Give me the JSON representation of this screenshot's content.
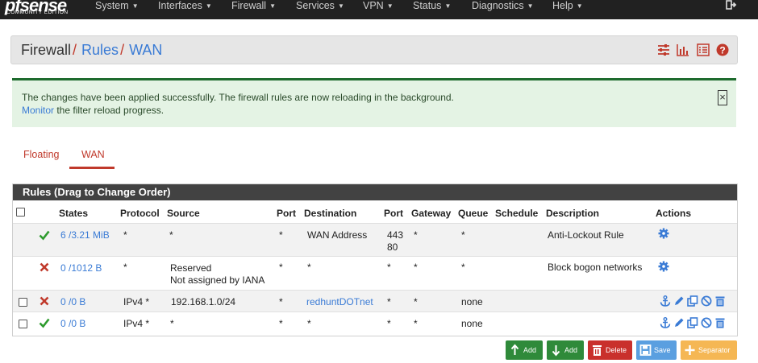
{
  "brand": {
    "logo_top": "pfsense",
    "logo_bottom": "COMMUNITY EDITION"
  },
  "nav": {
    "items": [
      {
        "label": "System"
      },
      {
        "label": "Interfaces"
      },
      {
        "label": "Firewall"
      },
      {
        "label": "Services"
      },
      {
        "label": "VPN"
      },
      {
        "label": "Status"
      },
      {
        "label": "Diagnostics"
      },
      {
        "label": "Help"
      }
    ]
  },
  "breadcrumb": {
    "root": "Firewall",
    "level2": "Rules",
    "level3": "WAN"
  },
  "alert": {
    "line1": "The changes have been applied successfully. The firewall rules are now reloading in the background.",
    "monitor_link": "Monitor",
    "line2_rest": " the filter reload progress.",
    "close": "×"
  },
  "tabs": [
    {
      "label": "Floating"
    },
    {
      "label": "WAN"
    }
  ],
  "panel": {
    "title": "Rules (Drag to Change Order)"
  },
  "table": {
    "headers": {
      "states": "States",
      "protocol": "Protocol",
      "source": "Source",
      "port": "Port",
      "destination": "Destination",
      "dport": "Port",
      "gateway": "Gateway",
      "queue": "Queue",
      "schedule": "Schedule",
      "description": "Description",
      "actions": "Actions"
    },
    "rows": [
      {
        "status": "pass",
        "states": "6 /3.21 MiB",
        "protocol": "*",
        "source": "*",
        "source2": "",
        "port": "*",
        "destination": "WAN Address",
        "dport": "443",
        "dport2": "80",
        "gateway": "*",
        "queue": "*",
        "schedule": "",
        "description": "Anti-Lockout Rule"
      },
      {
        "status": "block",
        "states": "0 /1012 B",
        "protocol": "*",
        "source": "Reserved",
        "source2": "Not assigned by IANA",
        "port": "*",
        "destination": "*",
        "dport": "*",
        "dport2": "",
        "gateway": "*",
        "queue": "*",
        "schedule": "",
        "description": "Block bogon networks"
      },
      {
        "status": "block",
        "states": "0 /0 B",
        "protocol": "IPv4 *",
        "source": "192.168.1.0/24",
        "source2": "",
        "port": "*",
        "destination": "redhuntDOTnet",
        "dport": "*",
        "dport2": "",
        "gateway": "*",
        "queue": "none",
        "schedule": "",
        "description": ""
      },
      {
        "status": "pass",
        "states": "0 /0 B",
        "protocol": "IPv4 *",
        "source": "*",
        "source2": "",
        "port": "*",
        "destination": "*",
        "dport": "*",
        "dport2": "",
        "gateway": "*",
        "queue": "none",
        "schedule": "",
        "description": ""
      }
    ]
  },
  "buttons": {
    "add_top": "Add",
    "add_bottom": "Add",
    "delete": "Delete",
    "save": "Save",
    "separator": "Separator"
  },
  "colors": {
    "pass": "#2e9b2e",
    "block": "#c0392b",
    "link": "#3a7bd5",
    "success_btn": "#2f8a3a",
    "danger_btn": "#c9302c",
    "primary_btn": "#5a9fe0",
    "warning_btn": "#f5b754"
  },
  "icons": [
    "sliders-icon",
    "bar-chart-icon",
    "list-icon",
    "help-icon",
    "logout-icon",
    "gear-icon",
    "anchor-icon",
    "pencil-icon",
    "copy-icon",
    "disable-icon",
    "trash-icon"
  ]
}
